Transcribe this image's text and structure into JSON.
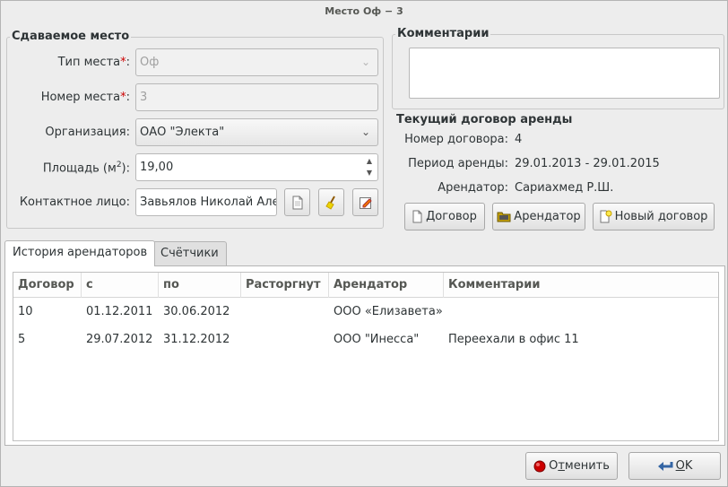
{
  "window": {
    "title": "Место Оф − 3"
  },
  "place_section": {
    "legend": "Сдаваемое место",
    "type": {
      "label": "Тип места",
      "required_mark": "*",
      "value": "Оф"
    },
    "number": {
      "label": "Номер места",
      "required_mark": "*",
      "value": "3"
    },
    "organization": {
      "label": "Организация:",
      "value": "ОАО \"Электа\""
    },
    "area": {
      "label_prefix": "Площадь (м",
      "label_sup": "2",
      "label_suffix": "):",
      "value": "19,00"
    },
    "contact": {
      "label": "Контактное лицо:",
      "value": "Завьялов Николай Але"
    },
    "colon": ":"
  },
  "comments_section": {
    "legend": "Комментарии",
    "value": ""
  },
  "contract_section": {
    "title": "Текущий договор аренды",
    "number_label": "Номер договора:",
    "number_value": "4",
    "period_label": "Период аренды:",
    "period_value": "29.01.2013 - 29.01.2015",
    "tenant_label": "Арендатор:",
    "tenant_value": "Сариахмед Р.Ш.",
    "buttons": {
      "contract": "Договор",
      "tenant": "Арендатор",
      "new_contract": "Новый договор"
    }
  },
  "tabs": [
    {
      "label": "История арендаторов",
      "active": true
    },
    {
      "label": "Счётчики",
      "active": false
    }
  ],
  "history_table": {
    "columns": [
      "Договор",
      "с",
      "по",
      "Расторгнут",
      "Арендатор",
      "Комментарии"
    ],
    "rows": [
      [
        "10",
        "01.12.2011",
        "30.06.2012",
        "",
        "ООО «Елизавета»",
        ""
      ],
      [
        "5",
        "29.07.2012",
        "31.12.2012",
        "",
        "ООО \"Инесса\"",
        "Переехали в офис 11"
      ]
    ]
  },
  "footer": {
    "cancel_prefix": "О",
    "cancel_mnemonic": "т",
    "cancel_suffix": "менить",
    "ok_mnemonic": "O",
    "ok_suffix": "K"
  },
  "colors": {
    "required": "#cc0000",
    "cancel_icon": "#cc0000",
    "ok_icon": "#3465a4"
  },
  "icons": [
    "chevron-down-icon",
    "spin-arrows-icon",
    "document-icon",
    "broom-icon",
    "edit-icon",
    "folder-icon",
    "new-document-icon",
    "record-icon",
    "return-arrow-icon"
  ]
}
